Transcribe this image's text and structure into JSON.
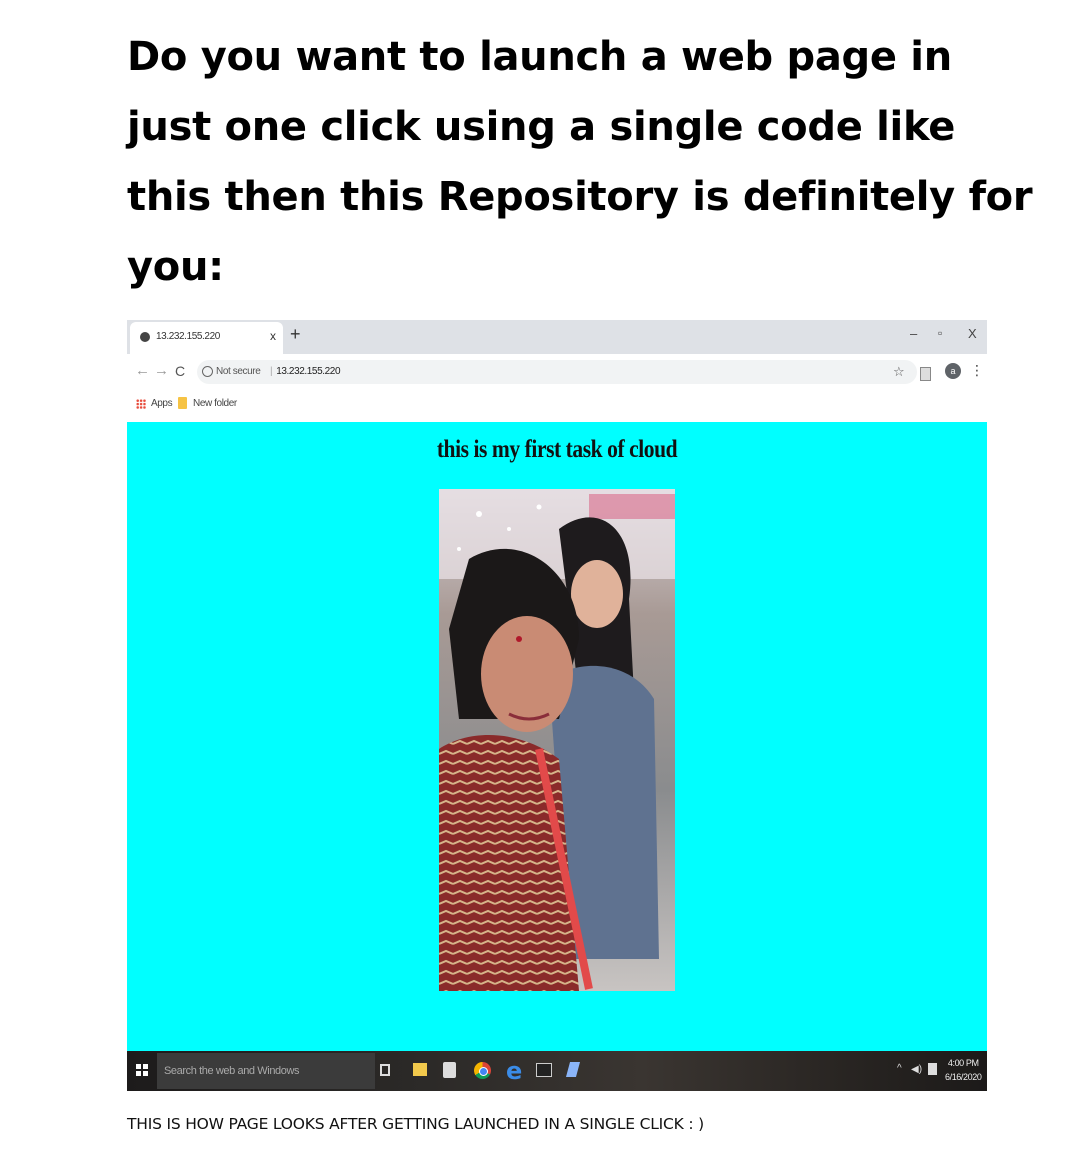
{
  "heading": {
    "line1": "Do you want to launch a web page in",
    "line2": "just one click using a single code like",
    "line3": "this then this Repository is definitely for",
    "line4": "you:"
  },
  "browser": {
    "tab_title": "13.232.155.220",
    "tab_close": "x",
    "new_tab": "+",
    "window_controls": {
      "minimize": "–",
      "maximize": "▫",
      "close": "X"
    },
    "address": {
      "security_label": "Not secure",
      "url": "13.232.155.220"
    },
    "profile_initial": "a",
    "bookmarks": [
      {
        "label": "Apps",
        "icon": "apps-grid-icon"
      },
      {
        "label": "New folder",
        "icon": "folder-icon"
      }
    ]
  },
  "webpage": {
    "heading": "this is my first task of cloud",
    "background": "#00ffff",
    "image": "photo of two women taking a selfie"
  },
  "taskbar": {
    "search_placeholder": "Search the web and Windows",
    "time": "4:00 PM",
    "date": "6/16/2020"
  },
  "caption": "THIS IS HOW PAGE LOOKS AFTER GETTING LAUNCHED IN A SINGLE CLICK : )"
}
